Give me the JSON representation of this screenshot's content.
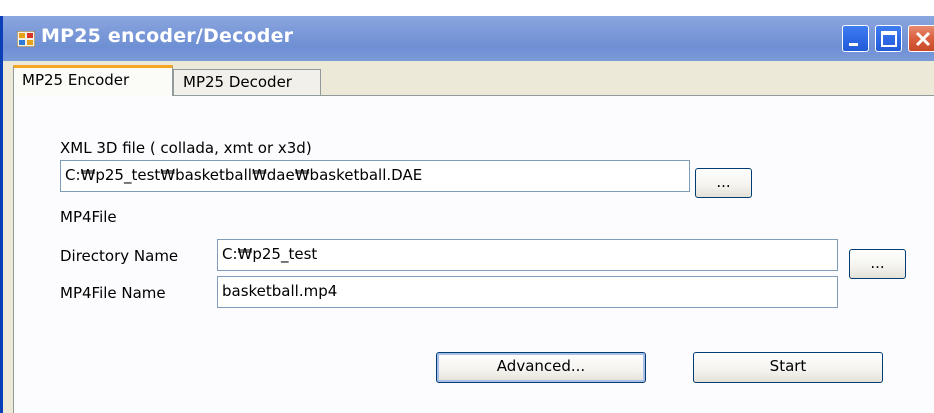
{
  "window": {
    "title": "MP25 encoder/Decoder",
    "icons": {
      "app": "app-window-icon",
      "minimize": "minimize-icon",
      "maximize": "maximize-icon",
      "close": "close-icon"
    }
  },
  "tabs": [
    {
      "label": "MP25 Encoder",
      "active": true
    },
    {
      "label": "MP25 Decoder",
      "active": false
    }
  ],
  "encoder": {
    "xml_label": "XML 3D file ( collada, xmt or x3d)",
    "xml_value": "C:₩p25_test₩basketball₩dae₩basketball.DAE",
    "xml_browse_label": "...",
    "mp4_section_label": "MP4File",
    "dir_label": "Directory Name",
    "dir_value": "C:₩p25_test",
    "dir_browse_label": "...",
    "file_label": "MP4File Name",
    "file_value": "basketball.mp4",
    "advanced_label": "Advanced...",
    "start_label": "Start"
  },
  "colors": {
    "titlebar": "#7a98d8",
    "active_tab_accent": "#f5a623",
    "window_border": "#0a3fb8"
  }
}
